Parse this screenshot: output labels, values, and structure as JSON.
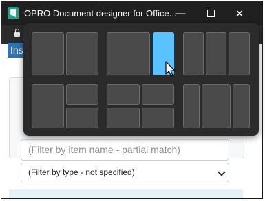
{
  "window": {
    "title": "OPRO Document designer for Office..."
  },
  "tab": {
    "label": "Ins"
  },
  "filters": {
    "name_placeholder": "(Filter by item name - partial match)",
    "type_selected": "(Filter by type - not specified)"
  },
  "snap_layouts": {
    "highlighted": "layout-2-right-zone"
  },
  "colors": {
    "highlight": "#5ac3ff",
    "tab": "#2f75b5"
  }
}
